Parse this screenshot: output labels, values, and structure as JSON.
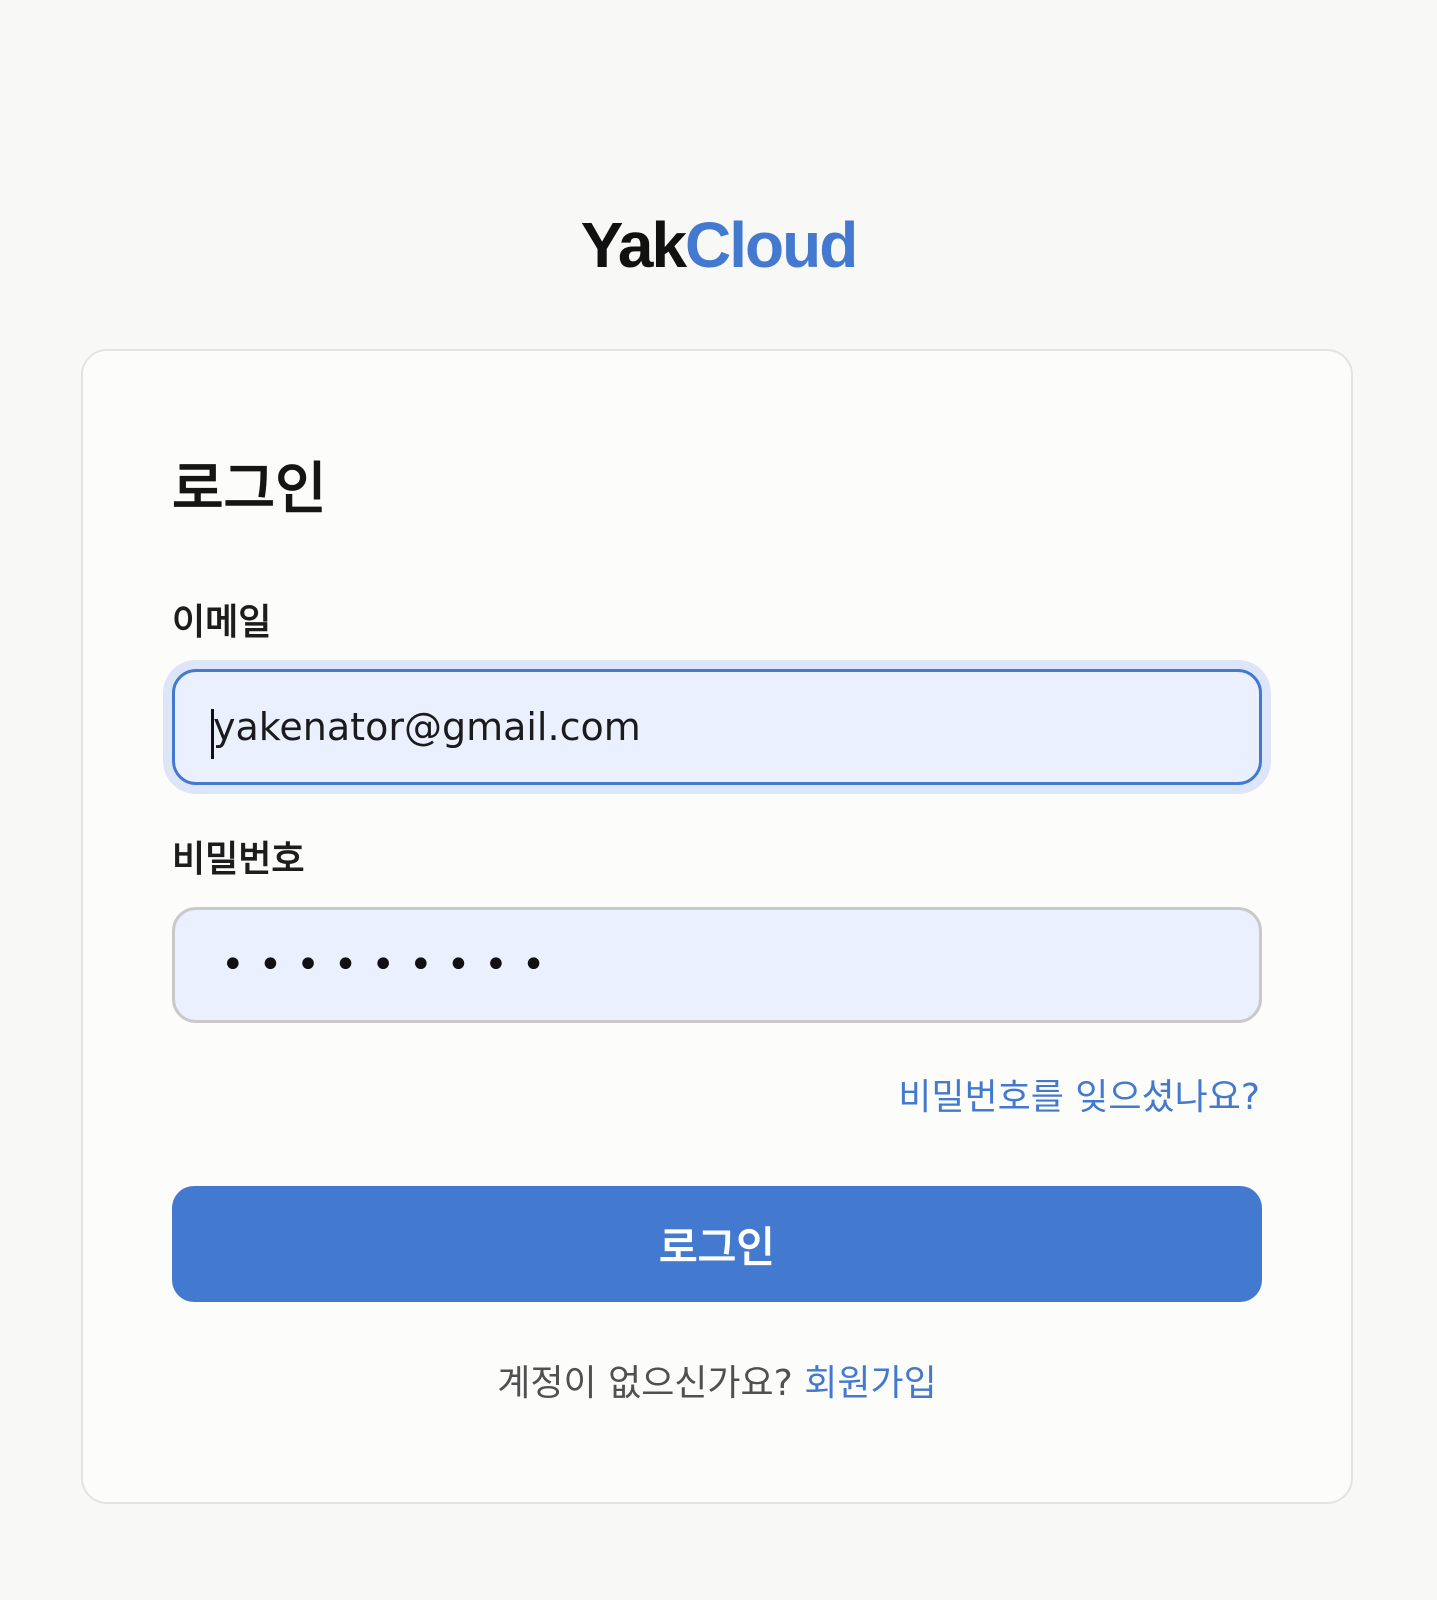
{
  "logo": {
    "part1": "Yak",
    "part2": "Cloud"
  },
  "colors": {
    "accent": "#4479d0",
    "background": "#f8f8f7",
    "input_fill": "#eaf0fd"
  },
  "login_form": {
    "title": "로그인",
    "email_label": "이메일",
    "email_value": "yakenator@gmail.com",
    "password_label": "비밀번호",
    "password_masked": "•••••••••",
    "forgot_password": "비밀번호를 잊으셨나요?",
    "submit_label": "로그인",
    "signup_prompt": "계정이 없으신가요?",
    "signup_link": "회원가입"
  }
}
